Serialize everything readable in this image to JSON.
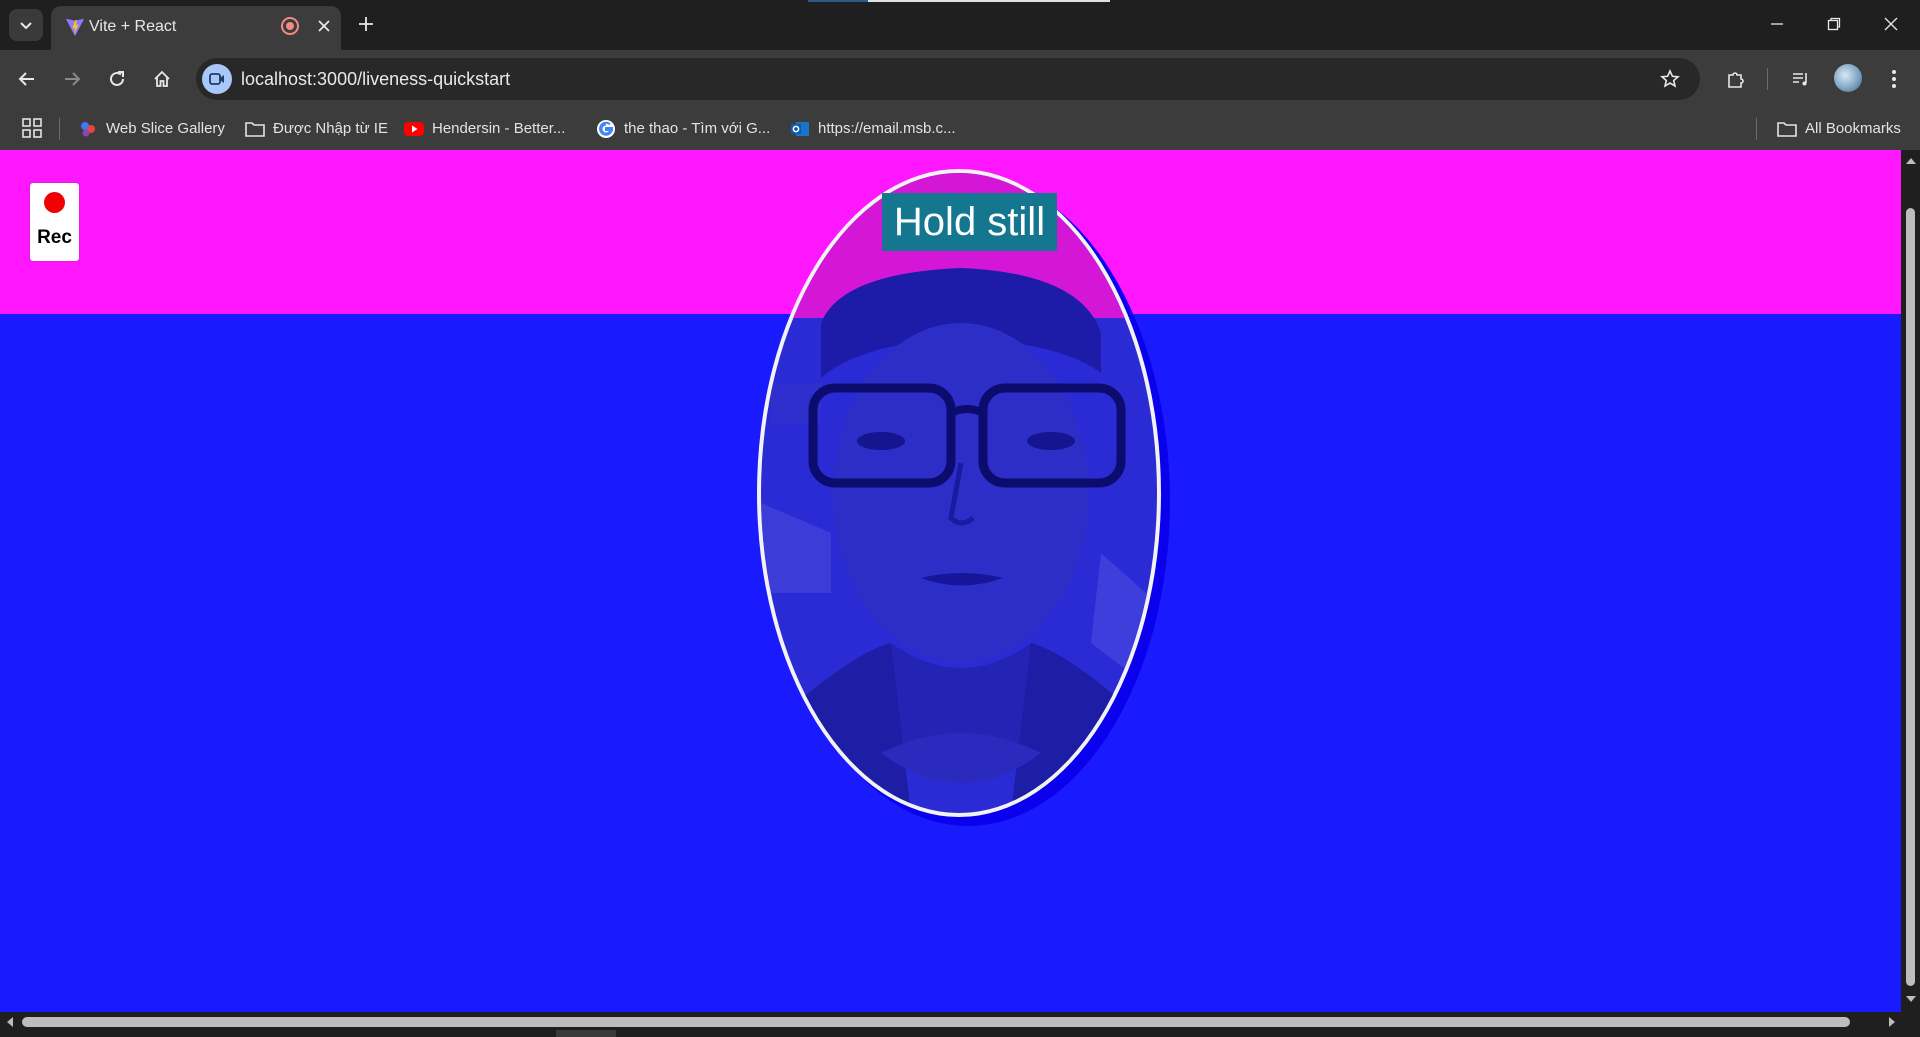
{
  "tab": {
    "title": "Vite + React"
  },
  "address": {
    "url": "localhost:3000/liveness-quickstart"
  },
  "bookmarks": {
    "items": [
      {
        "label": "Web Slice Gallery"
      },
      {
        "label": "Được Nhập từ IE"
      },
      {
        "label": "Hendersin - Better..."
      },
      {
        "label": "the thao - Tìm với G..."
      },
      {
        "label": "https://email.msb.c..."
      }
    ],
    "all_label": "All Bookmarks"
  },
  "page": {
    "rec_label": "Rec",
    "hint": "Hold still"
  },
  "colors": {
    "top_band": "#ff18ff",
    "background": "#1a1aff",
    "hint_bg": "#14778f",
    "rec_dot": "#f00000"
  }
}
